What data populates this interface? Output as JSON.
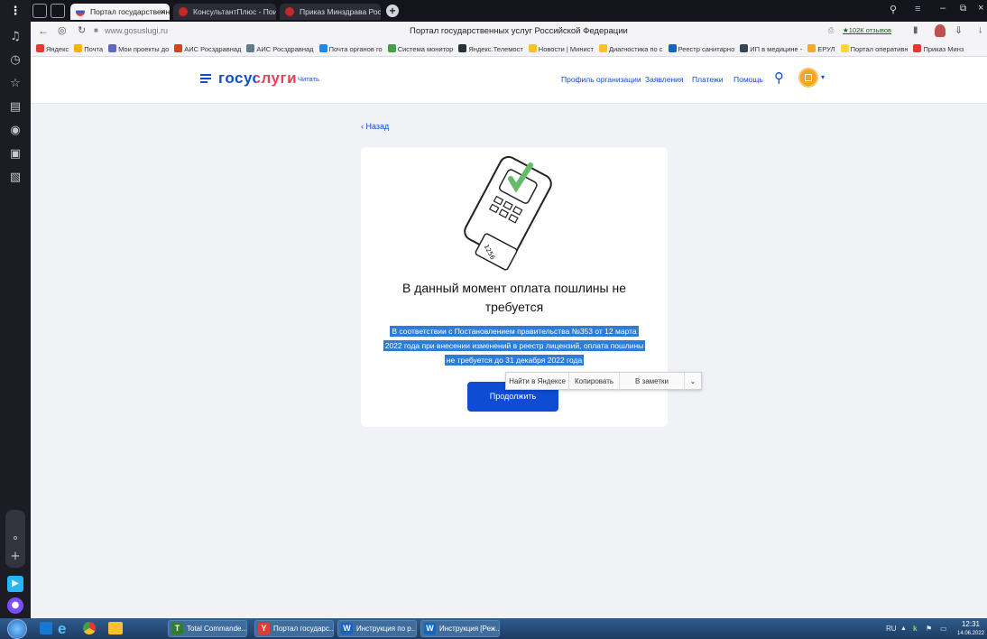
{
  "browser": {
    "tabs": [
      {
        "label": "Портал государственн",
        "close": "×",
        "color": "#e53935"
      },
      {
        "label": "КонсультантПлюс - Поиск",
        "color": "#c62828"
      },
      {
        "label": "Приказ Минздрава России",
        "color": "#c62828"
      }
    ],
    "new_tab": "+",
    "url": "www.gosuslugi.ru",
    "page_title": "Портал государственных услуг Российской Федерации",
    "reviews": "★102К отзывов",
    "bookmarks": [
      {
        "label": "Яндекс",
        "color": "#e53935"
      },
      {
        "label": "Почта",
        "color": "#ffb300"
      },
      {
        "label": "Мои проекты до",
        "color": "#5c6bc0"
      },
      {
        "label": "АИС Росздравнад",
        "color": "#d84315"
      },
      {
        "label": "АИС Росздравнад",
        "color": "#607d8b"
      },
      {
        "label": "Почта органов го",
        "color": "#1e88e5"
      },
      {
        "label": "Система монитор",
        "color": "#43a047"
      },
      {
        "label": "Яндекс.Телемост",
        "color": "#263238"
      },
      {
        "label": "Новости | Минист",
        "color": "#fbc02d"
      },
      {
        "label": "Диагностика по с",
        "color": "#fbc02d"
      },
      {
        "label": "Реестр санитарно",
        "color": "#1565c0"
      },
      {
        "label": "ИП в медицине -",
        "color": "#37474f"
      },
      {
        "label": "ЕРУЛ",
        "color": "#f9a825"
      },
      {
        "label": "Портал оперативн",
        "color": "#fdd835"
      },
      {
        "label": "Приказ Минз",
        "color": "#e53935"
      }
    ]
  },
  "header": {
    "logo_text": "госуслуги",
    "reader_label": "Читать",
    "nav": [
      "Профиль организации",
      "Заявления",
      "Платежи",
      "Помощь"
    ]
  },
  "main": {
    "back_label": "‹ Назад",
    "card": {
      "title": "В данный момент оплата пошлины не требуется",
      "description_lines": [
        "В соответствии с Постановлением правительства №353 от 12 марта",
        "2022 года при внесении изменений в реестр лицензий, оплата пошлины",
        "не требуется до 31 декабря 2022 года"
      ],
      "continue_label": "Продолжить",
      "receipt_number": "1256"
    },
    "context_menu": [
      "Найти в Яндексе",
      "Копировать",
      "В заметки"
    ]
  },
  "taskbar": {
    "items": [
      {
        "label": "Total Commande...",
        "color": "#2e7d32",
        "glyph": "T"
      },
      {
        "label": "Портал государс...",
        "color": "#e53935",
        "glyph": "Y"
      },
      {
        "label": "Инструкция по р...",
        "color": "#1565c0",
        "glyph": "W"
      },
      {
        "label": "Инструкция [Реж...",
        "color": "#1565c0",
        "glyph": "W"
      }
    ],
    "lang": "RU",
    "time": "12:31",
    "date": "14.06.2022"
  },
  "colors": {
    "accent": "#0d4cd3",
    "brand_red": "#ee3f58",
    "selection": "#2f7bd8",
    "page_bg": "#f1f2f5"
  }
}
